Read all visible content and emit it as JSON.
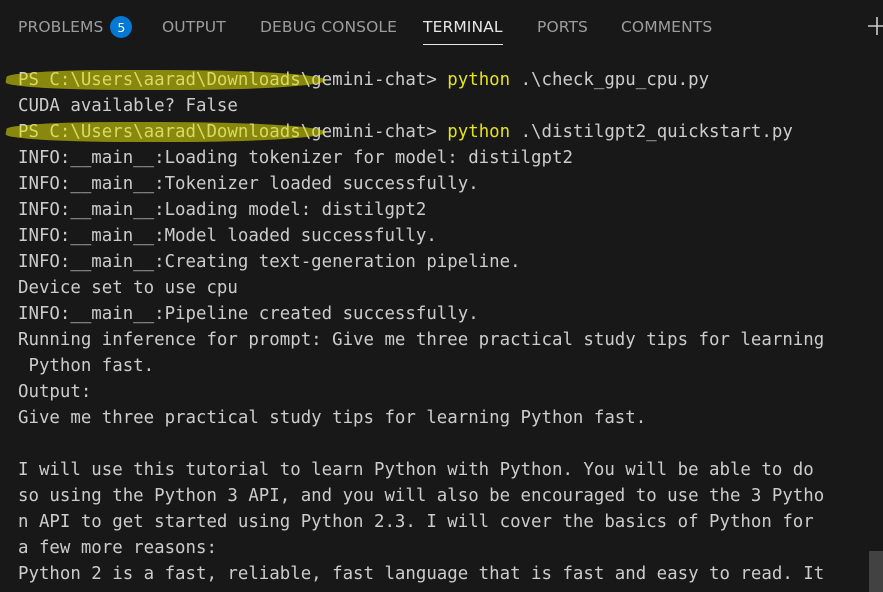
{
  "tabs": {
    "problems": "PROBLEMS",
    "problems_count": "5",
    "output": "OUTPUT",
    "debug_console": "DEBUG CONSOLE",
    "terminal": "TERMINAL",
    "ports": "PORTS",
    "comments": "COMMENTS"
  },
  "terminal": {
    "lines": [
      {
        "prompt": "PS C:\\Users\\aarad\\Downloads\\gemini-chat> ",
        "cmd": "python",
        "rest": " .\\check_gpu_cpu.py"
      },
      {
        "text": "CUDA available? False"
      },
      {
        "prompt": "PS C:\\Users\\aarad\\Downloads\\gemini-chat> ",
        "cmd": "python",
        "rest": " .\\distilgpt2_quickstart.py"
      },
      {
        "text": "INFO:__main__:Loading tokenizer for model: distilgpt2"
      },
      {
        "text": "INFO:__main__:Tokenizer loaded successfully."
      },
      {
        "text": "INFO:__main__:Loading model: distilgpt2"
      },
      {
        "text": "INFO:__main__:Model loaded successfully."
      },
      {
        "text": "INFO:__main__:Creating text-generation pipeline."
      },
      {
        "text": "Device set to use cpu"
      },
      {
        "text": "INFO:__main__:Pipeline created successfully."
      },
      {
        "text": "Running inference for prompt: Give me three practical study tips for learning"
      },
      {
        "text": " Python fast."
      },
      {
        "text": "Output:"
      },
      {
        "text": "Give me three practical study tips for learning Python fast."
      },
      {
        "text": ""
      },
      {
        "text": "I will use this tutorial to learn Python with Python. You will be able to do"
      },
      {
        "text": "so using the Python 3 API, and you will also be encouraged to use the 3 Pytho"
      },
      {
        "text": "n API to get started using Python 2.3. I will cover the basics of Python for"
      },
      {
        "text": "a few more reasons:"
      },
      {
        "text": "Python 2 is a fast, reliable, fast language that is fast and easy to read. It"
      }
    ]
  },
  "colors": {
    "background": "#181818",
    "command": "#e5e510",
    "badge": "#0078d4",
    "highlighter": "#e6e609"
  }
}
